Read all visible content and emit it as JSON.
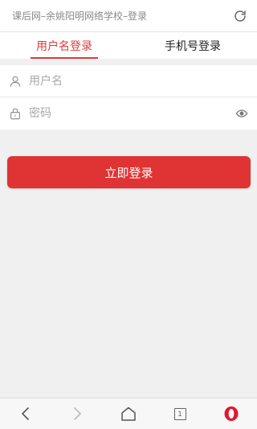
{
  "header": {
    "title": "课后网–余姚阳明网络学校–登录",
    "reload_icon": "reload-icon"
  },
  "tabs": [
    {
      "label": "用户名登录",
      "active": true
    },
    {
      "label": "手机号登录",
      "active": false
    }
  ],
  "form": {
    "username": {
      "placeholder": "用户名",
      "value": "",
      "icon": "user-icon"
    },
    "password": {
      "placeholder": "密码",
      "value": "",
      "icon": "lock-icon",
      "toggle_icon": "eye-icon"
    }
  },
  "login_button": {
    "label": "立即登录"
  },
  "bottom_nav": {
    "back_icon": "back-arrow-icon",
    "forward_icon": "forward-arrow-icon",
    "home_icon": "home-icon",
    "tab_count": "1",
    "opera_icon": "opera-logo-icon"
  },
  "colors": {
    "accent": "#e03434",
    "tab_active": "#e03a3a",
    "background": "#f0f0f0"
  }
}
